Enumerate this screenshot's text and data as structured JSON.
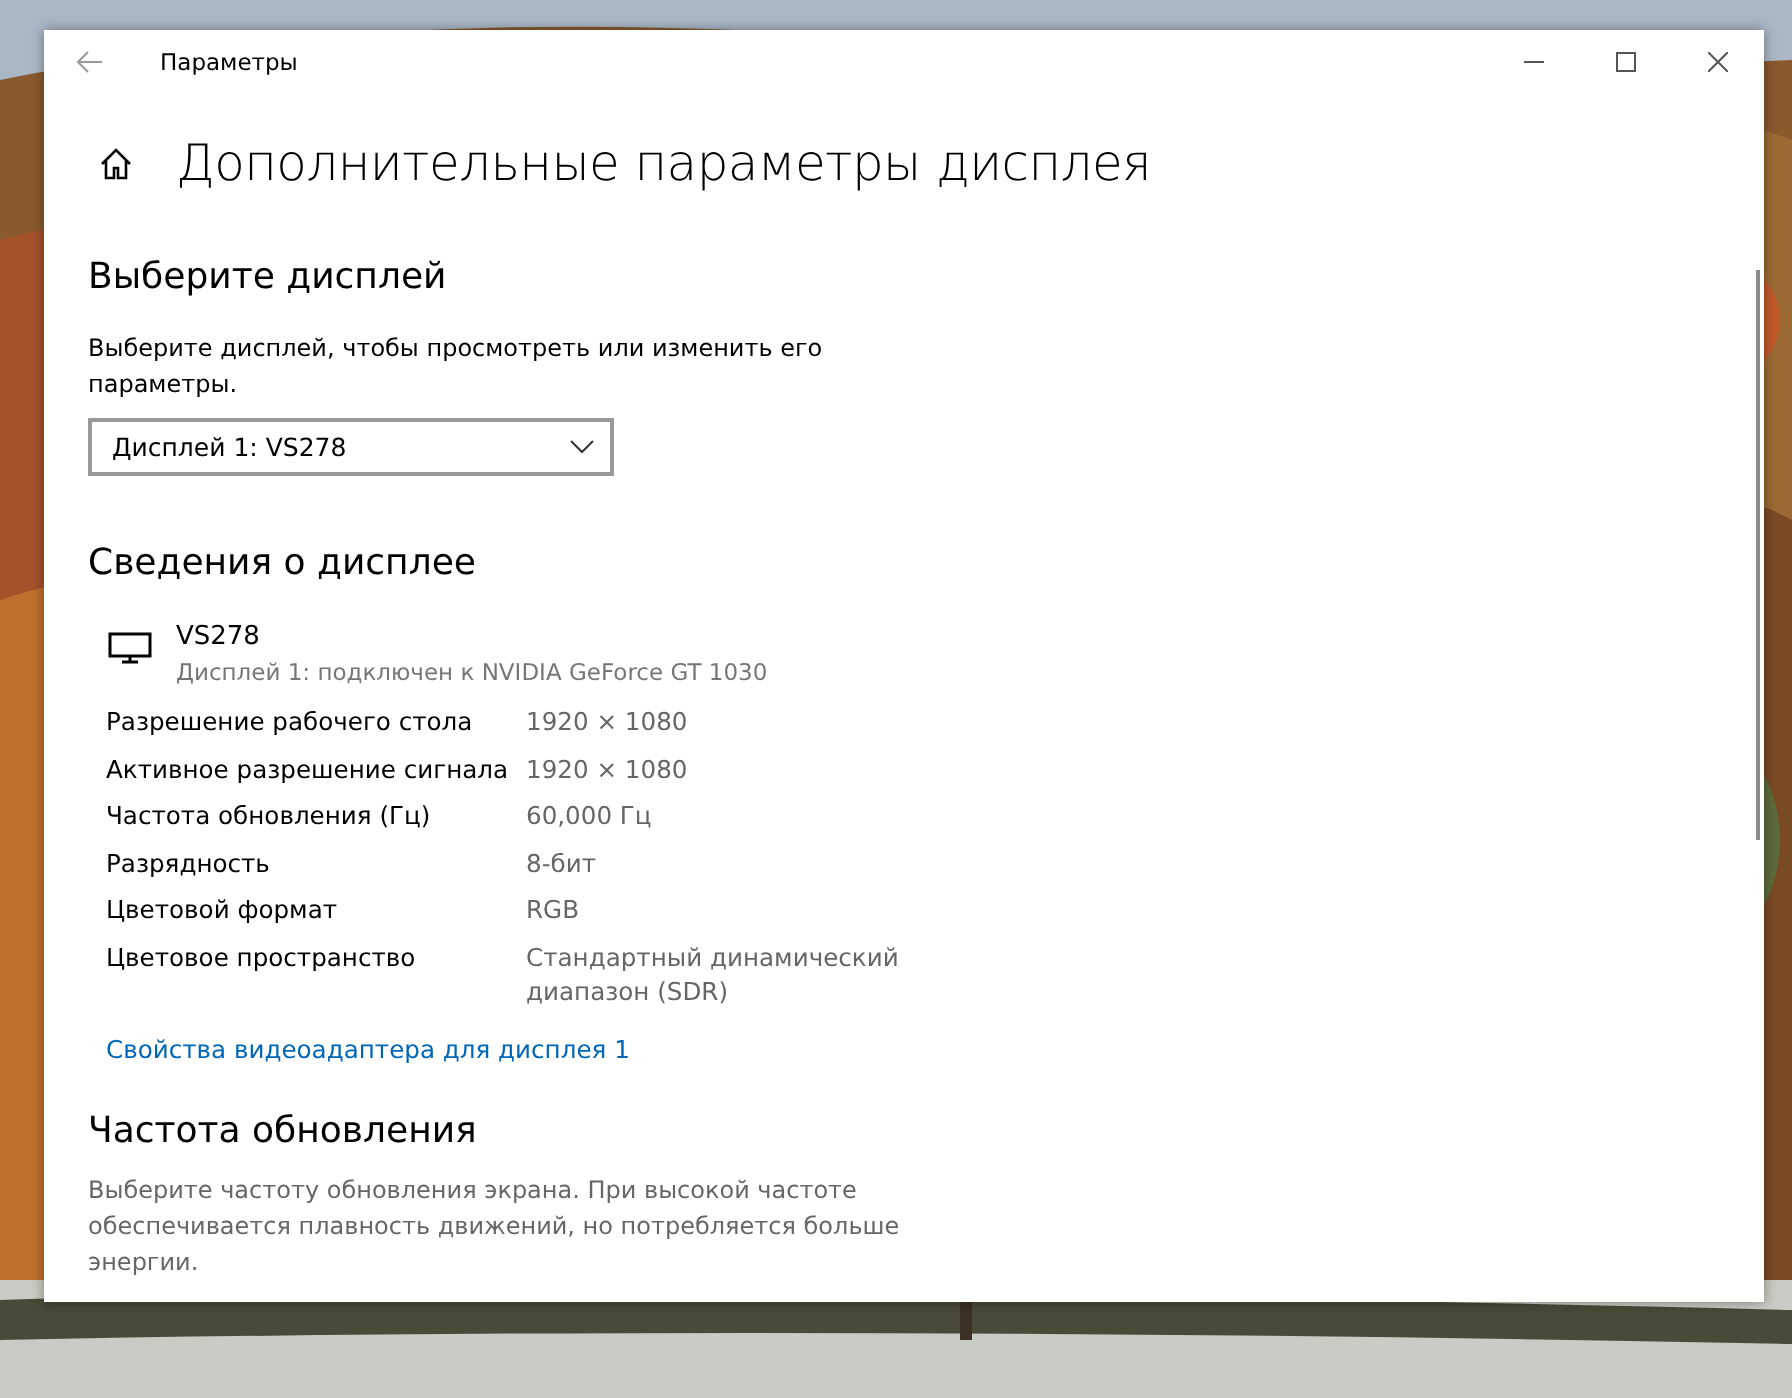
{
  "window": {
    "title": "Параметры",
    "kind": "picture"
  },
  "page_title": "Дополнительные параметры дисплея",
  "choose_display": {
    "heading": "Выберите дисплей",
    "description": "Выберите дисплей, чтобы просмотреть или изменить его параметры.",
    "dropdown": {
      "value": "Дисплей 1: VS278"
    }
  },
  "display_info": {
    "heading": "Сведения о дисплее",
    "monitor": {
      "name": "VS278",
      "subtitle": "Дисплей 1: подключен к NVIDIA GeForce GT 1030"
    },
    "rows": [
      {
        "label": "Разрешение рабочего стола",
        "value": "1920 × 1080"
      },
      {
        "label": "Активное разрешение сигнала",
        "value": "1920 × 1080"
      },
      {
        "label": "Частота обновления (Гц)",
        "value": "60,000 Гц"
      },
      {
        "label": "Разрядность",
        "value": "8-бит"
      },
      {
        "label": "Цветовой формат",
        "value": "RGB"
      },
      {
        "label": "Цветовое пространство",
        "value": "Стандартный динамический диапазон (SDR)"
      }
    ],
    "link": "Свойства видеоадаптера для дисплея 1"
  },
  "refresh_rate": {
    "heading": "Частота обновления",
    "description": "Выберите частоту обновления экрана. При высокой частоте обеспечивается плавность движений, но потребляется больше энергии."
  }
}
